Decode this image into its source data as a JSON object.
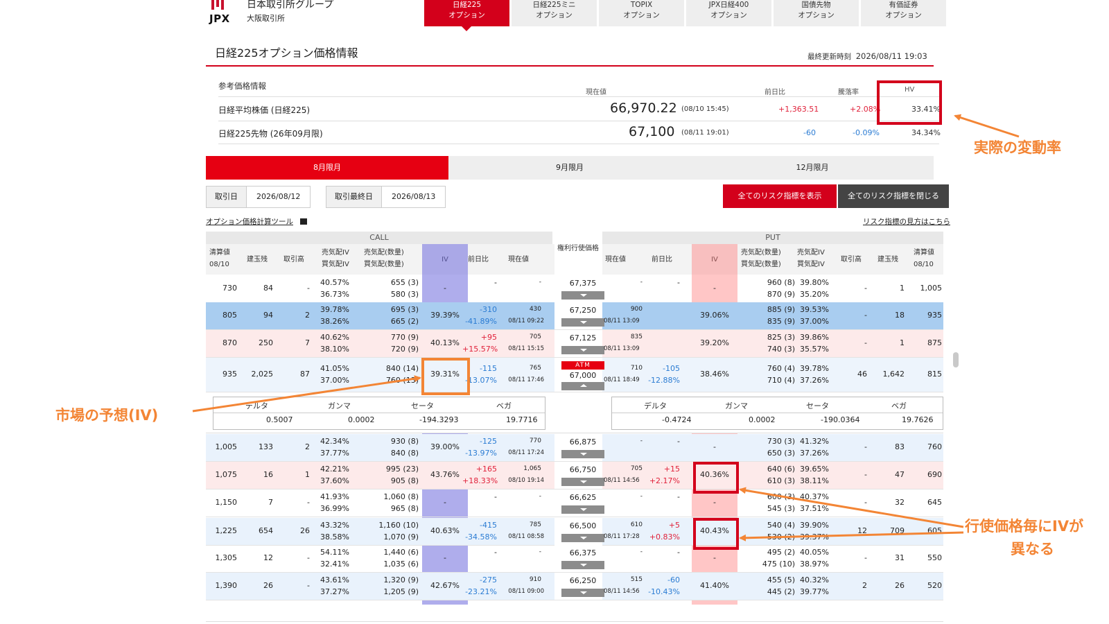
{
  "header": {
    "logo_text": "JPX",
    "group_name": "日本取引所グループ",
    "exchange_name": "大阪取引所",
    "nav_tabs": [
      {
        "line1": "日経225",
        "line2": "オプション"
      },
      {
        "line1": "日経225ミニ",
        "line2": "オプション"
      },
      {
        "line1": "TOPIX",
        "line2": "オプション"
      },
      {
        "line1": "JPX日経400",
        "line2": "オプション"
      },
      {
        "line1": "国債先物",
        "line2": "オプション"
      },
      {
        "line1": "有価証券",
        "line2": "オプション"
      }
    ]
  },
  "page_title": "日経225オプション価格情報",
  "last_update_label": "最終更新時刻",
  "last_update": "2026/08/11 19:03",
  "reference": {
    "heading": "参考価格情報",
    "columns": {
      "price": "現在値",
      "change": "前日比",
      "rate": "騰落率",
      "hv": "HV"
    },
    "rows": [
      {
        "name": "日経平均株価 (日経225)",
        "price": "66,970.22",
        "time": "(08/10 15:45)",
        "change": "+1,363.51",
        "rate": "+2.08%",
        "hv": "33.41%"
      },
      {
        "name": "日経225先物 (26年09月限)",
        "price": "67,100",
        "time": "(08/11 19:01)",
        "change": "-60",
        "rate": "-0.09%",
        "hv": "34.34%"
      }
    ]
  },
  "annotations": {
    "hv": "実際の変動率",
    "iv": "市場の予想(IV)",
    "iv_strikes_line1": "行使価格毎にIVが",
    "iv_strikes_line2": "異なる"
  },
  "month_tabs": [
    "8月限月",
    "9月限月",
    "12月限月"
  ],
  "trade_date_label": "取引日",
  "trade_date": "2026/08/12",
  "last_trade_label": "取引最終日",
  "last_trade_date": "2026/08/13",
  "btn_show_all": "全てのリスク指標を表示",
  "btn_hide_all": "全てのリスク指標を閉じる",
  "calc_tool_link": "オプション価格計算ツール",
  "risk_help_link": "リスク指標の見方はこちら",
  "table": {
    "call_label": "CALL",
    "put_label": "PUT",
    "strike_header": "権利行使価格",
    "headers_call": [
      "清算値 08/10",
      "建玉残",
      "取引高",
      "売気配IV 買気配IV",
      "売気配(数量) 買気配(数量)",
      "IV",
      "前日比",
      "現在値"
    ],
    "headers_put": [
      "現在値",
      "前日比",
      "IV",
      "売気配(数量) 買気配(数量)",
      "売気配IV 買気配IV",
      "取引高",
      "建玉残",
      "清算値 08/10"
    ],
    "atm_label": "ATM",
    "rows": [
      {
        "c_settle": "730",
        "c_oi": "84",
        "c_vol": "-",
        "c_ask_iv": "40.57%",
        "c_bid_iv": "36.73%",
        "c_ask": "655 (3)",
        "c_bid": "580 (3)",
        "c_iv": "-",
        "c_chg1": "-",
        "c_chg2": "",
        "c_last": "-",
        "c_time": "",
        "strike": "67,375",
        "p_last": "-",
        "p_time": "",
        "p_chg1": "-",
        "p_chg2": "",
        "p_iv": "-",
        "p_ask": "960 (8)",
        "p_bid": "870 (9)",
        "p_ask_iv": "39.80%",
        "p_bid_iv": "35.20%",
        "p_vol": "-",
        "p_oi": "1",
        "p_settle": "1,005"
      },
      {
        "c_settle": "805",
        "c_oi": "94",
        "c_vol": "2",
        "c_ask_iv": "39.78%",
        "c_bid_iv": "38.26%",
        "c_ask": "695 (3)",
        "c_bid": "665 (2)",
        "c_iv": "39.39%",
        "c_chg1": "-310",
        "c_chg2": "-41.89%",
        "c_last": "430",
        "c_time": "08/11 09:22",
        "strike": "67,250",
        "p_last": "900",
        "p_time": "08/11 13:09",
        "p_chg1": "",
        "p_chg2": "",
        "p_iv": "39.06%",
        "p_ask": "885 (9)",
        "p_bid": "835 (9)",
        "p_ask_iv": "39.53%",
        "p_bid_iv": "37.00%",
        "p_vol": "-",
        "p_oi": "18",
        "p_settle": "935"
      },
      {
        "c_settle": "870",
        "c_oi": "250",
        "c_vol": "7",
        "c_ask_iv": "40.62%",
        "c_bid_iv": "38.10%",
        "c_ask": "770 (9)",
        "c_bid": "720 (9)",
        "c_iv": "40.13%",
        "c_chg1": "+95",
        "c_chg2": "+15.57%",
        "c_last": "705",
        "c_time": "08/11 15:15",
        "strike": "67,125",
        "p_last": "835",
        "p_time": "08/11 13:09",
        "p_chg1": "",
        "p_chg2": "",
        "p_iv": "39.20%",
        "p_ask": "825 (3)",
        "p_bid": "740 (3)",
        "p_ask_iv": "39.86%",
        "p_bid_iv": "35.57%",
        "p_vol": "-",
        "p_oi": "1",
        "p_settle": "875"
      },
      {
        "c_settle": "935",
        "c_oi": "2,025",
        "c_vol": "87",
        "c_ask_iv": "41.05%",
        "c_bid_iv": "37.00%",
        "c_ask": "840 (14)",
        "c_bid": "760 (13)",
        "c_iv": "39.31%",
        "c_chg1": "-115",
        "c_chg2": "-13.07%",
        "c_last": "765",
        "c_time": "08/11 17:46",
        "strike": "67,000",
        "p_last": "710",
        "p_time": "08/11 18:49",
        "p_chg1": "-105",
        "p_chg2": "-12.88%",
        "p_iv": "38.46%",
        "p_ask": "760 (4)",
        "p_bid": "710 (4)",
        "p_ask_iv": "39.78%",
        "p_bid_iv": "37.26%",
        "p_vol": "46",
        "p_oi": "1,642",
        "p_settle": "815"
      },
      {
        "c_settle": "1,005",
        "c_oi": "133",
        "c_vol": "2",
        "c_ask_iv": "42.34%",
        "c_bid_iv": "37.77%",
        "c_ask": "930 (8)",
        "c_bid": "840 (8)",
        "c_iv": "39.00%",
        "c_chg1": "-125",
        "c_chg2": "-13.97%",
        "c_last": "770",
        "c_time": "08/11 17:24",
        "strike": "66,875",
        "p_last": "-",
        "p_time": "",
        "p_chg1": "-",
        "p_chg2": "",
        "p_iv": "-",
        "p_ask": "730 (3)",
        "p_bid": "650 (3)",
        "p_ask_iv": "41.32%",
        "p_bid_iv": "37.26%",
        "p_vol": "-",
        "p_oi": "83",
        "p_settle": "760"
      },
      {
        "c_settle": "1,075",
        "c_oi": "16",
        "c_vol": "1",
        "c_ask_iv": "42.21%",
        "c_bid_iv": "37.60%",
        "c_ask": "995 (23)",
        "c_bid": "905 (8)",
        "c_iv": "43.76%",
        "c_chg1": "+165",
        "c_chg2": "+18.33%",
        "c_last": "1,065",
        "c_time": "08/10 19:14",
        "strike": "66,750",
        "p_last": "705",
        "p_time": "08/11 14:56",
        "p_chg1": "+15",
        "p_chg2": "+2.17%",
        "p_iv": "40.36%",
        "p_ask": "640 (6)",
        "p_bid": "610 (3)",
        "p_ask_iv": "39.65%",
        "p_bid_iv": "38.11%",
        "p_vol": "-",
        "p_oi": "47",
        "p_settle": "690"
      },
      {
        "c_settle": "1,150",
        "c_oi": "7",
        "c_vol": "-",
        "c_ask_iv": "41.93%",
        "c_bid_iv": "36.99%",
        "c_ask": "1,060 (8)",
        "c_bid": "965 (8)",
        "c_iv": "-",
        "c_chg1": "-",
        "c_chg2": "",
        "c_last": "-",
        "c_time": "",
        "strike": "66,625",
        "p_last": "-",
        "p_time": "",
        "p_chg1": "-",
        "p_chg2": "",
        "p_iv": "-",
        "p_ask": "600 (3)",
        "p_bid": "545 (3)",
        "p_ask_iv": "40.37%",
        "p_bid_iv": "37.51%",
        "p_vol": "-",
        "p_oi": "32",
        "p_settle": "645"
      },
      {
        "c_settle": "1,225",
        "c_oi": "654",
        "c_vol": "26",
        "c_ask_iv": "43.32%",
        "c_bid_iv": "38.58%",
        "c_ask": "1,160 (10)",
        "c_bid": "1,070 (9)",
        "c_iv": "40.63%",
        "c_chg1": "-415",
        "c_chg2": "-34.58%",
        "c_last": "785",
        "c_time": "08/11 08:58",
        "strike": "66,500",
        "p_last": "610",
        "p_time": "08/11 17:28",
        "p_chg1": "+5",
        "p_chg2": "+0.83%",
        "p_iv": "40.43%",
        "p_ask": "540 (4)",
        "p_bid": "530 (2)",
        "p_ask_iv": "39.90%",
        "p_bid_iv": "39.37%",
        "p_vol": "12",
        "p_oi": "709",
        "p_settle": "605"
      },
      {
        "c_settle": "1,305",
        "c_oi": "12",
        "c_vol": "-",
        "c_ask_iv": "54.11%",
        "c_bid_iv": "32.41%",
        "c_ask": "1,440 (6)",
        "c_bid": "1,035 (6)",
        "c_iv": "-",
        "c_chg1": "-",
        "c_chg2": "",
        "c_last": "-",
        "c_time": "",
        "strike": "66,375",
        "p_last": "-",
        "p_time": "",
        "p_chg1": "-",
        "p_chg2": "",
        "p_iv": "-",
        "p_ask": "495 (2)",
        "p_bid": "475 (10)",
        "p_ask_iv": "40.05%",
        "p_bid_iv": "38.97%",
        "p_vol": "-",
        "p_oi": "31",
        "p_settle": "550"
      },
      {
        "c_settle": "1,390",
        "c_oi": "26",
        "c_vol": "-",
        "c_ask_iv": "43.61%",
        "c_bid_iv": "37.27%",
        "c_ask": "1,320 (9)",
        "c_bid": "1,205 (9)",
        "c_iv": "42.67%",
        "c_chg1": "-275",
        "c_chg2": "-23.21%",
        "c_last": "910",
        "c_time": "08/11 09:00",
        "strike": "66,250",
        "p_last": "515",
        "p_time": "08/11 14:56",
        "p_chg1": "-60",
        "p_chg2": "-10.43%",
        "p_iv": "41.40%",
        "p_ask": "455 (5)",
        "p_bid": "445 (2)",
        "p_ask_iv": "40.32%",
        "p_bid_iv": "39.77%",
        "p_vol": "2",
        "p_oi": "26",
        "p_settle": "520"
      }
    ],
    "greeks": {
      "labels": [
        "デルタ",
        "ガンマ",
        "セータ",
        "ベガ"
      ],
      "call": [
        "0.5007",
        "0.0002",
        "-194.3293",
        "19.7716"
      ],
      "put": [
        "-0.4724",
        "0.0002",
        "-190.0364",
        "19.7626"
      ]
    }
  }
}
